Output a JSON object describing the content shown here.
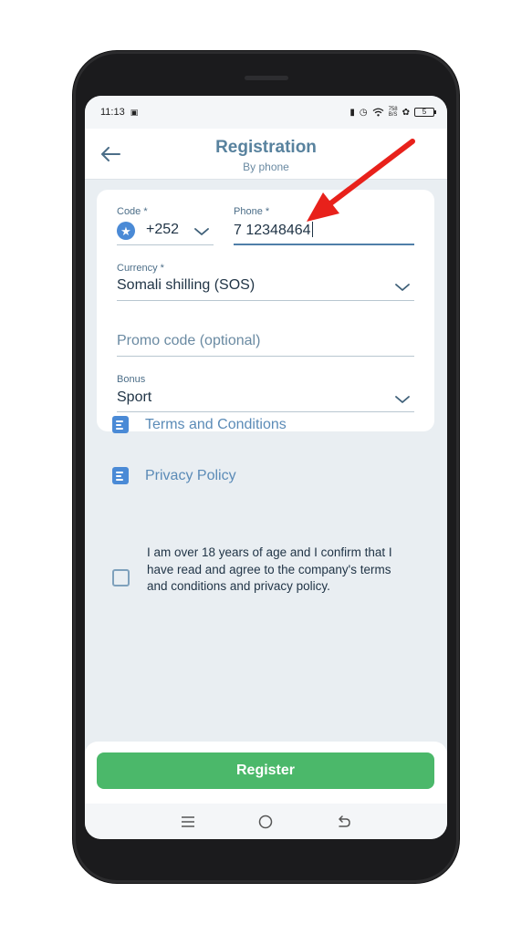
{
  "status_bar": {
    "time": "11:13",
    "speed_top": "758",
    "speed_bottom": "B/S",
    "battery": "5"
  },
  "header": {
    "title": "Registration",
    "subtitle": "By phone",
    "back_icon": "arrow-left-icon"
  },
  "form": {
    "code": {
      "label": "Code *",
      "value": "+252",
      "flag_icon": "somalia-flag-icon"
    },
    "phone": {
      "label": "Phone *",
      "value": "7 12348464"
    },
    "currency": {
      "label": "Currency *",
      "value": "Somali shilling (SOS)"
    },
    "promo": {
      "placeholder": "Promo code (optional)"
    },
    "bonus": {
      "label": "Bonus",
      "value": "Sport"
    }
  },
  "links": {
    "terms": "Terms and Conditions",
    "privacy": "Privacy Policy"
  },
  "agreement": {
    "text": "I am over 18 years of age and I confirm that I have read and agree to the company's terms and conditions and privacy policy.",
    "checked": false
  },
  "register_label": "Register",
  "colors": {
    "accent": "#4f7fa8",
    "title": "#58829e",
    "register": "#4bb86a",
    "link": "#5b8bb7",
    "annotation_arrow": "#e8211b"
  }
}
